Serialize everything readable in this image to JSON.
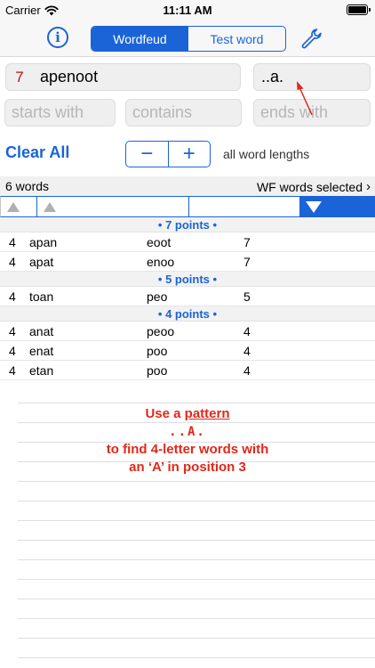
{
  "status": {
    "carrier": "Carrier",
    "time": "11:11 AM"
  },
  "toolbar": {
    "info_glyph": "i",
    "tabs": [
      {
        "label": "Wordfeud",
        "active": true
      },
      {
        "label": "Test word",
        "active": false
      }
    ],
    "settings_icon": "wrench-icon"
  },
  "search": {
    "letter_count": "7",
    "letters": "apenoot",
    "pattern": "..a.",
    "starts_placeholder": "starts with",
    "contains_placeholder": "contains",
    "ends_placeholder": "ends with"
  },
  "controls": {
    "clear_all": "Clear All",
    "minus": "−",
    "plus": "+",
    "lengths_label": "all word lengths"
  },
  "list": {
    "count_label": "6 words",
    "selection_label": "WF words selected",
    "groups": [
      {
        "label": "• 7 points •",
        "rows": [
          {
            "len": "4",
            "word": "apan",
            "remaining": "eoot",
            "points": "7"
          },
          {
            "len": "4",
            "word": "apat",
            "remaining": "enoo",
            "points": "7"
          }
        ]
      },
      {
        "label": "• 5 points •",
        "rows": [
          {
            "len": "4",
            "word": "toan",
            "remaining": "peo",
            "points": "5"
          }
        ]
      },
      {
        "label": "• 4 points •",
        "rows": [
          {
            "len": "4",
            "word": "anat",
            "remaining": "peoo",
            "points": "4"
          },
          {
            "len": "4",
            "word": "enat",
            "remaining": "poo",
            "points": "4"
          },
          {
            "len": "4",
            "word": "etan",
            "remaining": "poo",
            "points": "4"
          }
        ]
      }
    ]
  },
  "hint": {
    "line1_prefix": "Use a",
    "line1_link": "pattern",
    "pattern_example": "..A.",
    "line3": "to find 4-letter words with",
    "line4": "an ‘A’ in position 3"
  },
  "colors": {
    "accent": "#1a64d8",
    "hint": "#e0281a",
    "count": "#c01010"
  }
}
